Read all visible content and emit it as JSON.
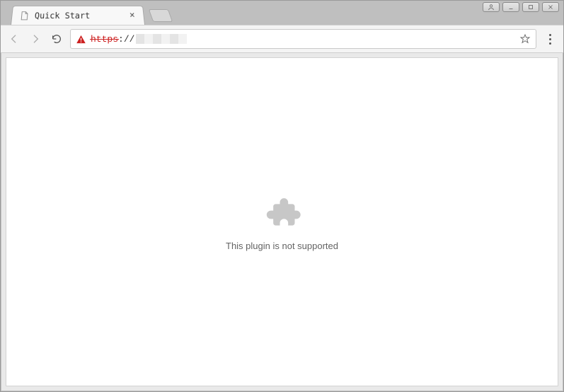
{
  "window_controls": {
    "user": "user",
    "minimize": "minimize",
    "maximize": "maximize",
    "close": "close"
  },
  "tabs": [
    {
      "title": "Quick Start",
      "icon": "page-icon"
    }
  ],
  "toolbar": {
    "back": "back",
    "forward": "forward",
    "reload": "reload",
    "url": {
      "security_state": "not-secure",
      "security_icon": "warning-triangle-icon",
      "scheme": "https",
      "separator": "://",
      "host_obscured": true
    },
    "bookmark": "bookmark",
    "menu": "menu"
  },
  "page": {
    "plugin_message": "This plugin is not supported",
    "plugin_icon": "puzzle-piece-icon"
  }
}
